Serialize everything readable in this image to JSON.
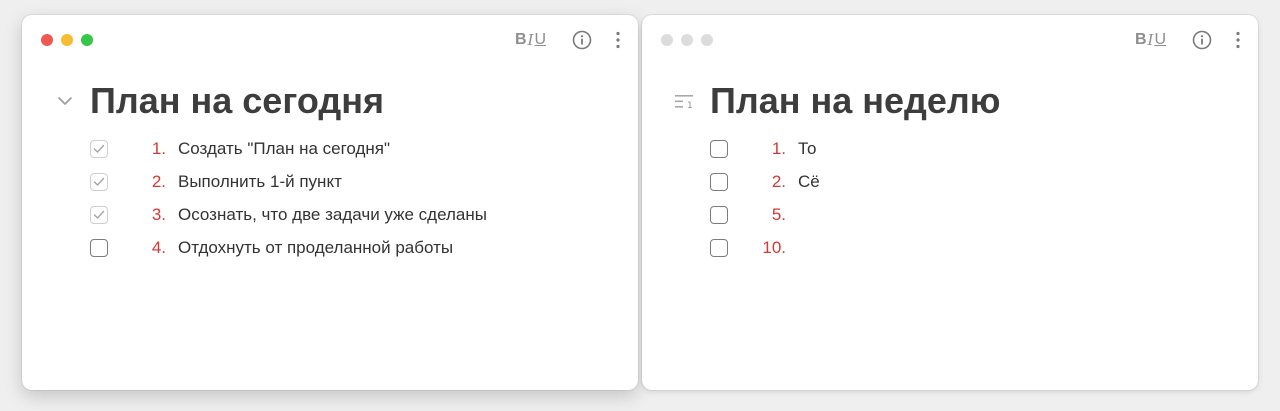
{
  "colors": {
    "accent_number": "#d23a35",
    "traffic_red": "#ee5a52",
    "traffic_yellow": "#f5bd2f",
    "traffic_green": "#34c749",
    "text": "#333333",
    "icon_gray": "#8e8e8e"
  },
  "toolbar": {
    "bold_glyph": "B",
    "italic_glyph": "I",
    "underline_glyph": "U",
    "info_icon": "info-icon",
    "more_icon": "vertical-dots-icon"
  },
  "left_window": {
    "title": "План на сегодня",
    "title_icon": "chevron-down-icon",
    "items": [
      {
        "checked": true,
        "number": "1.",
        "text": "Создать \"План на сегодня\""
      },
      {
        "checked": true,
        "number": "2.",
        "text": "Выполнить 1-й пункт"
      },
      {
        "checked": true,
        "number": "3.",
        "text": "Осознать, что две задачи уже сделаны"
      },
      {
        "checked": false,
        "number": "4.",
        "text": "Отдохнуть от проделанной работы"
      }
    ]
  },
  "right_window": {
    "title": "План на неделю",
    "title_icon": "numbered-list-icon",
    "items": [
      {
        "checked": false,
        "number": "1.",
        "text": "То"
      },
      {
        "checked": false,
        "number": "2.",
        "text": "Сё"
      },
      {
        "checked": false,
        "number": "5.",
        "text": ""
      },
      {
        "checked": false,
        "number": "10.",
        "text": ""
      }
    ]
  }
}
